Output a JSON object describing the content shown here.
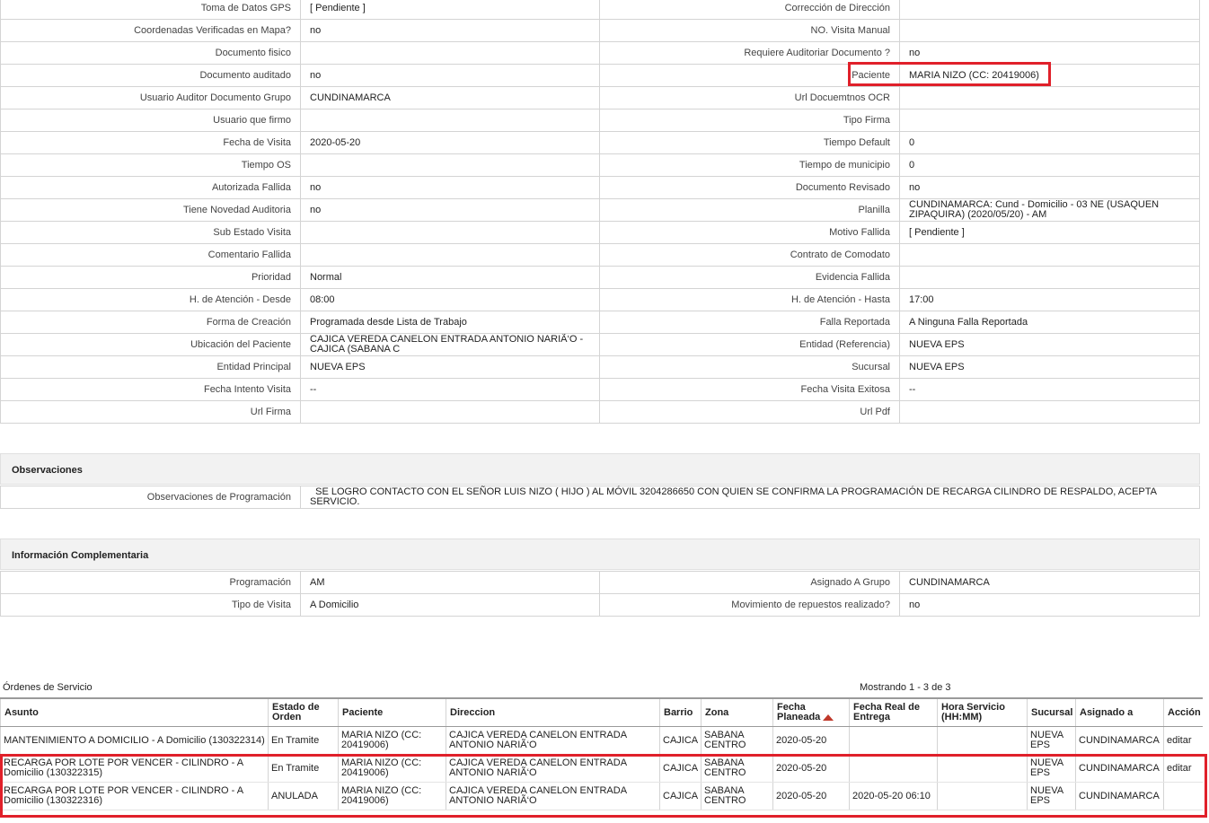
{
  "fields": [
    {
      "left_label": "Toma de Datos GPS",
      "left_value": "[ Pendiente ]",
      "right_label": "Corrección de Dirección",
      "right_value": ""
    },
    {
      "left_label": "Coordenadas Verificadas en Mapa?",
      "left_value": " no",
      "right_label": "NO. Visita Manual",
      "right_value": ""
    },
    {
      "left_label": "Documento fisico",
      "left_value": "",
      "right_label": "Requiere Auditoriar Documento ?",
      "right_value": " no"
    },
    {
      "left_label": "Documento auditado",
      "left_value": " no",
      "right_label": "Paciente",
      "right_value": "MARIA NIZO (CC: 20419006)"
    },
    {
      "left_label": "Usuario Auditor Documento Grupo",
      "left_value": "CUNDINAMARCA",
      "right_label": "Url Docuemtnos OCR",
      "right_value": ""
    },
    {
      "left_label": "Usuario que firmo",
      "left_value": "",
      "right_label": "Tipo Firma",
      "right_value": ""
    },
    {
      "left_label": "Fecha de Visita",
      "left_value": " 2020-05-20",
      "right_label": "Tiempo Default",
      "right_value": "0"
    },
    {
      "left_label": "Tiempo OS",
      "left_value": "",
      "right_label": "Tiempo de municipio",
      "right_value": "0"
    },
    {
      "left_label": "Autorizada Fallida",
      "left_value": " no",
      "right_label": "Documento Revisado",
      "right_value": " no"
    },
    {
      "left_label": "Tiene Novedad Auditoria",
      "left_value": " no",
      "right_label": "Planilla",
      "right_value": "CUNDINAMARCA: Cund - Domicilio - 03 NE (USAQUEN ZIPAQUIRA) (2020/05/20) - AM"
    },
    {
      "left_label": "Sub Estado Visita",
      "left_value": "",
      "right_label": "Motivo Fallida",
      "right_value": "[ Pendiente ]"
    },
    {
      "left_label": "Comentario Fallida",
      "left_value": "",
      "right_label": "Contrato de Comodato",
      "right_value": ""
    },
    {
      "left_label": "Prioridad",
      "left_value": "Normal",
      "right_label": "Evidencia Fallida",
      "right_value": ""
    },
    {
      "left_label": "H. de Atención - Desde",
      "left_value": "08:00",
      "right_label": "H. de Atención - Hasta",
      "right_value": "17:00"
    },
    {
      "left_label": "Forma de Creación",
      "left_value": "Programada desde Lista de Trabajo",
      "right_label": "Falla Reportada",
      "right_value": "A Ninguna Falla Reportada"
    },
    {
      "left_label": "Ubicación del Paciente",
      "left_value": "CAJICA VEREDA CANELON ENTRADA ANTONIO NARIÃ‘O - CAJICA (SABANA C",
      "right_label": "Entidad (Referencia)",
      "right_value": "NUEVA EPS"
    },
    {
      "left_label": "Entidad Principal",
      "left_value": "NUEVA EPS",
      "right_label": "Sucursal",
      "right_value": "NUEVA EPS"
    },
    {
      "left_label": "Fecha Intento Visita",
      "left_value": " --",
      "right_label": "Fecha Visita Exitosa",
      "right_value": " --"
    },
    {
      "left_label": "Url Firma",
      "left_value": "",
      "right_label": "Url Pdf",
      "right_value": ""
    }
  ],
  "observaciones": {
    "title": "Observaciones",
    "label": "Observaciones de Programación",
    "value": "  SE LOGRO CONTACTO CON EL SEÑOR LUIS NIZO ( HIJO ) AL MÓVIL 3204286650 CON QUIEN SE CONFIRMA LA PROGRAMACIÓN DE RECARGA CILINDRO DE RESPALDO, ACEPTA SERVICIO."
  },
  "complementaria": {
    "title": "Información Complementaria",
    "rows": [
      {
        "left_label": "Programación",
        "left_value": "AM",
        "right_label": "Asignado A Grupo",
        "right_value": "CUNDINAMARCA"
      },
      {
        "left_label": "Tipo de Visita",
        "left_value": "A Domicilio",
        "right_label": "Movimiento de repuestos realizado?",
        "right_value": " no"
      }
    ]
  },
  "orders": {
    "title": "Órdenes de Servicio",
    "count": "Mostrando 1 - 3 de 3",
    "columns": [
      "Asunto",
      "Estado de Orden",
      "Paciente",
      "Direccion",
      "Barrio",
      "Zona",
      "Fecha Planeada",
      "Fecha Real de Entrega",
      "Hora Servicio (HH:MM)",
      "Sucursal",
      "Asignado a",
      "Acción"
    ],
    "rows": [
      {
        "asunto": "MANTENIMIENTO A DOMICILIO - A Domicilio (130322314)",
        "estado": "En Tramite",
        "paciente": "MARIA NIZO (CC: 20419006)",
        "direccion": "CAJICA VEREDA CANELON ENTRADA ANTONIO NARIÃ‘O",
        "barrio": "CAJICA",
        "zona": "SABANA CENTRO",
        "fecha_planeada": "2020-05-20",
        "fecha_real": "",
        "hora": "",
        "sucursal": "NUEVA EPS",
        "asignado": "CUNDINAMARCA",
        "accion": "editar"
      },
      {
        "asunto": "RECARGA POR LOTE POR VENCER - CILINDRO - A Domicilio (130322315)",
        "estado": "En Tramite",
        "paciente": "MARIA NIZO (CC: 20419006)",
        "direccion": "CAJICA VEREDA CANELON ENTRADA ANTONIO NARIÃ‘O",
        "barrio": "CAJICA",
        "zona": "SABANA CENTRO",
        "fecha_planeada": "2020-05-20",
        "fecha_real": "",
        "hora": "",
        "sucursal": "NUEVA EPS",
        "asignado": "CUNDINAMARCA",
        "accion": "editar"
      },
      {
        "asunto": "RECARGA POR LOTE POR VENCER - CILINDRO - A Domicilio (130322316)",
        "estado": "ANULADA",
        "paciente": "MARIA NIZO (CC: 20419006)",
        "direccion": "CAJICA VEREDA CANELON ENTRADA ANTONIO NARIÃ‘O",
        "barrio": "CAJICA",
        "zona": "SABANA CENTRO",
        "fecha_planeada": "2020-05-20",
        "fecha_real": "2020-05-20 06:10",
        "hora": "",
        "sucursal": "NUEVA EPS",
        "asignado": "CUNDINAMARCA",
        "accion": ""
      }
    ]
  },
  "colors": {
    "highlight": "#e0202a",
    "sort_arrow": "#c0392b"
  }
}
